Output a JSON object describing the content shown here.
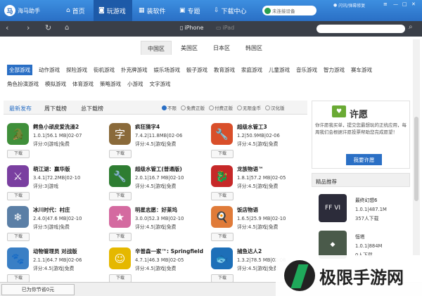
{
  "app": {
    "name": "海马助手"
  },
  "nav": {
    "home": "首页",
    "games": "玩游戏",
    "software": "装软件",
    "topics": "专题",
    "downloads": "下载中心"
  },
  "device_button": "未连接设备",
  "user": {
    "name": "闪讯/弹幕修复"
  },
  "toolbar": {
    "device_iphone": "iPhone",
    "device_ipad": "iPad",
    "search_placeholder": ""
  },
  "regions": [
    "中国区",
    "美国区",
    "日本区",
    "韩国区"
  ],
  "categories": {
    "row1": [
      "全部游戏",
      "动作游戏",
      "探险游戏",
      "街机游戏",
      "扑克牌游戏",
      "娱乐场游戏",
      "骰子游戏",
      "教育游戏",
      "家庭游戏",
      "儿童游戏",
      "音乐游戏",
      "智力游戏",
      "赛车游戏"
    ],
    "row2": [
      "角色扮演游戏",
      "模拟游戏",
      "体育游戏",
      "策略游戏",
      "小游戏",
      "文字游戏"
    ]
  },
  "sort_tabs": [
    "最新发布",
    "周下载榜",
    "总下载榜"
  ],
  "filters": [
    "不限",
    "免费正版",
    "付费正版",
    "无限金币",
    "汉化版"
  ],
  "download_label": "下载",
  "apps": [
    {
      "name": "鳄鱼小顽皮爱洗澡2",
      "meta": "1.0.1|56.1 MB|02-07",
      "score": "评分:0|游戏|免费",
      "icon": "crocodile-icon",
      "color": "#3f8f3a",
      "glyph": "🐊"
    },
    {
      "name": "疯狂猜字4",
      "meta": "7.4.2|11.8MB|02-06",
      "score": "评分:4.5|游戏|免费",
      "icon": "word-guess-icon",
      "color": "#8a6a3a",
      "glyph": "字"
    },
    {
      "name": "超级水管工3",
      "meta": "1.2|50.9MB|02-06",
      "score": "评分:4.5|游戏|免费",
      "icon": "plumber-icon",
      "color": "#d94f2a",
      "glyph": "🔧"
    },
    {
      "name": "萌江湖：赢华版",
      "meta": "3.4.1|72.2MB|02-10",
      "score": "评分:3|游戏",
      "icon": "anime-hero-icon",
      "color": "#7a3fa0",
      "glyph": "⚔"
    },
    {
      "name": "超级水管工(普通版)",
      "meta": "2.0.1|16.7 MB|02-10",
      "score": "评分:4.5|游戏|免费",
      "icon": "plumber-classic-icon",
      "color": "#2e7d32",
      "glyph": "🔧"
    },
    {
      "name": "龙族物语™",
      "meta": "1.8.1|57.2 MB|02-05",
      "score": "评分:4.5|游戏|免费",
      "icon": "dragon-icon",
      "color": "#c62828",
      "glyph": "🐉"
    },
    {
      "name": "冰川时代：村庄",
      "meta": "2.4.0|47.6 MB|02-10",
      "score": "评分:5|游戏|免费",
      "icon": "ice-age-icon",
      "color": "#5b7fa6",
      "glyph": "❄"
    },
    {
      "name": "明星志愿：好莱坞",
      "meta": "3.0.0|52.3 MB|02-10",
      "score": "评分:4.5|游戏|免费",
      "icon": "star-girl-icon",
      "color": "#d46aa0",
      "glyph": "★"
    },
    {
      "name": "饭店物语",
      "meta": "1.6.5|25.9 MB|02-10",
      "score": "评分:4.5|游戏|免费",
      "icon": "restaurant-icon",
      "color": "#e07b39",
      "glyph": "🍳"
    },
    {
      "name": "动物管理员 对战版",
      "meta": "2.1.1|64.7 MB|02-06",
      "score": "评分:4.5|游戏|免费",
      "icon": "zookeeper-icon",
      "color": "#3a7fc5",
      "glyph": "🐾"
    },
    {
      "name": "辛普森一家™: Springfield",
      "meta": "4.7.1|46.3 MB|02-05",
      "score": "评分:4.5|游戏|免费",
      "icon": "simpsons-icon",
      "color": "#e5b800",
      "glyph": "☺"
    },
    {
      "name": "捕鱼达人2",
      "meta": "1.3.2|78.5 MB|02-06",
      "score": "评分:4.5|游戏|免费",
      "icon": "fishing-icon",
      "color": "#1d6fb8",
      "glyph": "🐟"
    }
  ],
  "wish": {
    "title": "许愿",
    "text_a": "你许愿我买单，提交您最想玩的正统应用，每周我们会根据许愿投票帮助您完成愿望！",
    "button": "我要许愿"
  },
  "recommend": {
    "heading": "精品推荐",
    "items": [
      {
        "name": "最终幻想6",
        "meta": "1.0.1|487.1M",
        "users": "357人下载",
        "icon": "final-fantasy-icon",
        "color": "#2c2c3a",
        "glyph": "FF VI"
      },
      {
        "name": "恒塔",
        "meta": "1.0.1|884M",
        "users": "0人下载",
        "icon": "tower-icon",
        "color": "#4a5a4a",
        "glyph": "◆"
      }
    ]
  },
  "status": {
    "saved": "已为你节省0元"
  },
  "watermark": {
    "text": "极限手游网"
  }
}
